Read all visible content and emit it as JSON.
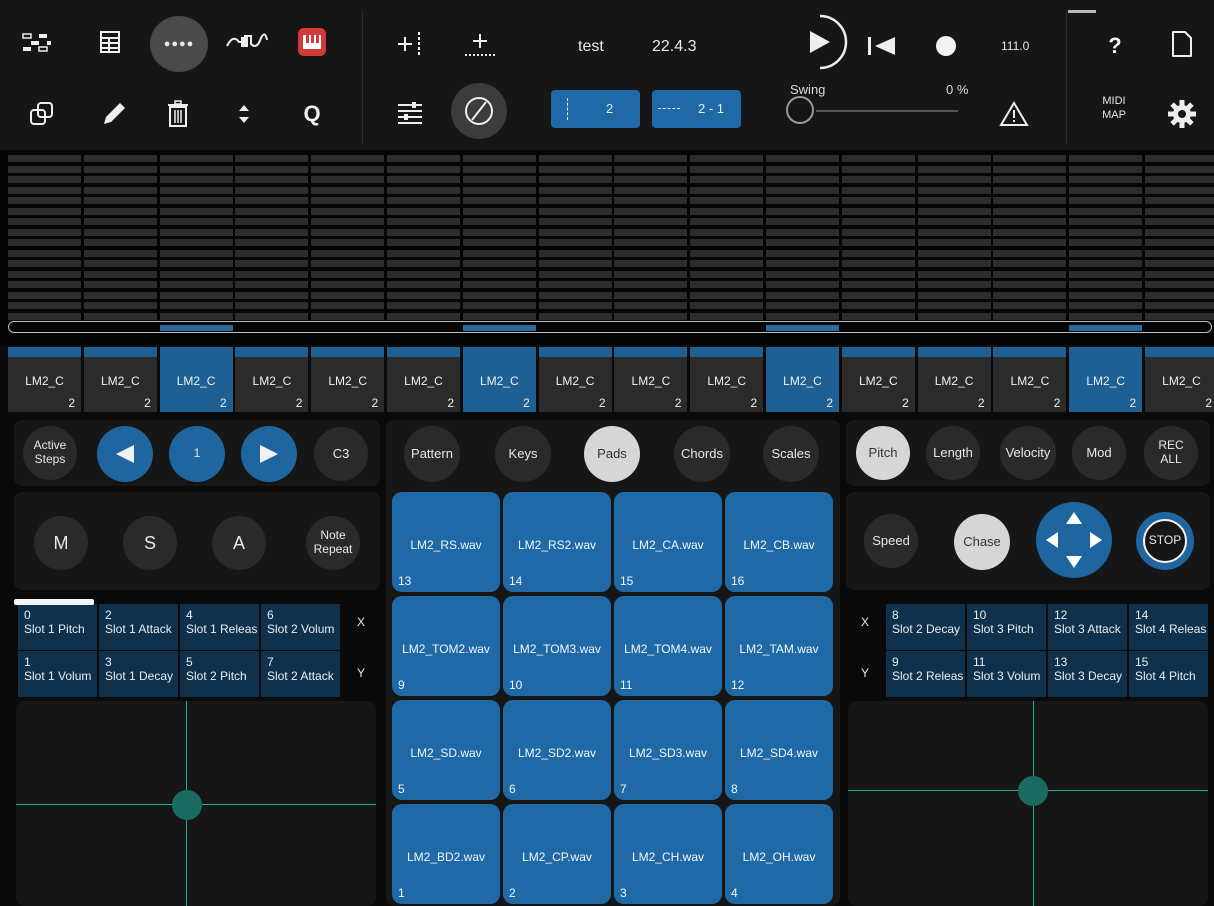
{
  "toolbar": {
    "song_name": "test",
    "position": "22.4.3",
    "tempo": "111.0",
    "swing_label": "Swing",
    "swing_value": "0 %",
    "quantize_label": "Q",
    "help_label": "?",
    "midi_map_label_1": "MIDI",
    "midi_map_label_2": "MAP",
    "dots_label": "●●●●",
    "grid_value": "2",
    "length_value": "2 - 1"
  },
  "channels": [
    {
      "name": "LM2_C",
      "num": "2",
      "selected": false
    },
    {
      "name": "LM2_C",
      "num": "2",
      "selected": false
    },
    {
      "name": "LM2_C",
      "num": "2",
      "selected": true
    },
    {
      "name": "LM2_C",
      "num": "2",
      "selected": false
    },
    {
      "name": "LM2_C",
      "num": "2",
      "selected": false
    },
    {
      "name": "LM2_C",
      "num": "2",
      "selected": false
    },
    {
      "name": "LM2_C",
      "num": "2",
      "selected": true
    },
    {
      "name": "LM2_C",
      "num": "2",
      "selected": false
    },
    {
      "name": "LM2_C",
      "num": "2",
      "selected": false
    },
    {
      "name": "LM2_C",
      "num": "2",
      "selected": false
    },
    {
      "name": "LM2_C",
      "num": "2",
      "selected": true
    },
    {
      "name": "LM2_C",
      "num": "2",
      "selected": false
    },
    {
      "name": "LM2_C",
      "num": "2",
      "selected": false
    },
    {
      "name": "LM2_C",
      "num": "2",
      "selected": false
    },
    {
      "name": "LM2_C",
      "num": "2",
      "selected": true
    },
    {
      "name": "LM2_C",
      "num": "2",
      "selected": false
    }
  ],
  "left_controls": {
    "active_steps_1": "Active",
    "active_steps_2": "Steps",
    "page_value": "1",
    "note_value": "C3",
    "mute": "M",
    "solo": "S",
    "arm": "A",
    "note_repeat_1": "Note",
    "note_repeat_2": "Repeat",
    "x_label": "X",
    "y_label": "Y"
  },
  "left_slots": [
    {
      "num": "0",
      "label": "Slot 1 Pitch"
    },
    {
      "num": "2",
      "label": "Slot 1 Attack"
    },
    {
      "num": "4",
      "label": "Slot 1 Releas"
    },
    {
      "num": "6",
      "label": "Slot 2 Volum"
    },
    {
      "num": "1",
      "label": "Slot 1 Volum"
    },
    {
      "num": "3",
      "label": "Slot 1 Decay"
    },
    {
      "num": "5",
      "label": "Slot 2 Pitch"
    },
    {
      "num": "7",
      "label": "Slot 2 Attack"
    }
  ],
  "mode_tabs": [
    "Pattern",
    "Keys",
    "Pads",
    "Chords",
    "Scales"
  ],
  "pads": [
    {
      "name": "LM2_RS.wav",
      "num": "13"
    },
    {
      "name": "LM2_RS2.wav",
      "num": "14"
    },
    {
      "name": "LM2_CA.wav",
      "num": "15"
    },
    {
      "name": "LM2_CB.wav",
      "num": "16"
    },
    {
      "name": "LM2_TOM2.wav",
      "num": "9"
    },
    {
      "name": "LM2_TOM3.wav",
      "num": "10"
    },
    {
      "name": "LM2_TOM4.wav",
      "num": "11"
    },
    {
      "name": "LM2_TAM.wav",
      "num": "12"
    },
    {
      "name": "LM2_SD.wav",
      "num": "5"
    },
    {
      "name": "LM2_SD2.wav",
      "num": "6"
    },
    {
      "name": "LM2_SD3.wav",
      "num": "7"
    },
    {
      "name": "LM2_SD4.wav",
      "num": "8"
    },
    {
      "name": "LM2_BD2.wav",
      "num": "1"
    },
    {
      "name": "LM2_CP.wav",
      "num": "2"
    },
    {
      "name": "LM2_CH.wav",
      "num": "3"
    },
    {
      "name": "LM2_OH.wav",
      "num": "4"
    }
  ],
  "right_tabs": {
    "pitch": "Pitch",
    "length": "Length",
    "velocity": "Velocity",
    "mod": "Mod",
    "rec_1": "REC",
    "rec_2": "ALL"
  },
  "right_controls": {
    "speed": "Speed",
    "chase": "Chase",
    "stop": "STOP",
    "x_label": "X",
    "y_label": "Y"
  },
  "right_slots": [
    {
      "num": "8",
      "label": "Slot 2 Decay"
    },
    {
      "num": "10",
      "label": "Slot 3 Pitch"
    },
    {
      "num": "12",
      "label": "Slot 3 Attack"
    },
    {
      "num": "14",
      "label": "Slot 4 Releas"
    },
    {
      "num": "9",
      "label": "Slot 2 Releas"
    },
    {
      "num": "11",
      "label": "Slot 3 Volum"
    },
    {
      "num": "13",
      "label": "Slot 3 Decay"
    },
    {
      "num": "15",
      "label": "Slot 4 Pitch"
    }
  ],
  "colors": {
    "accent": "#1f6aa6",
    "background": "#0a0a0a",
    "panel": "#161616",
    "xy_line": "#2aa69a"
  }
}
